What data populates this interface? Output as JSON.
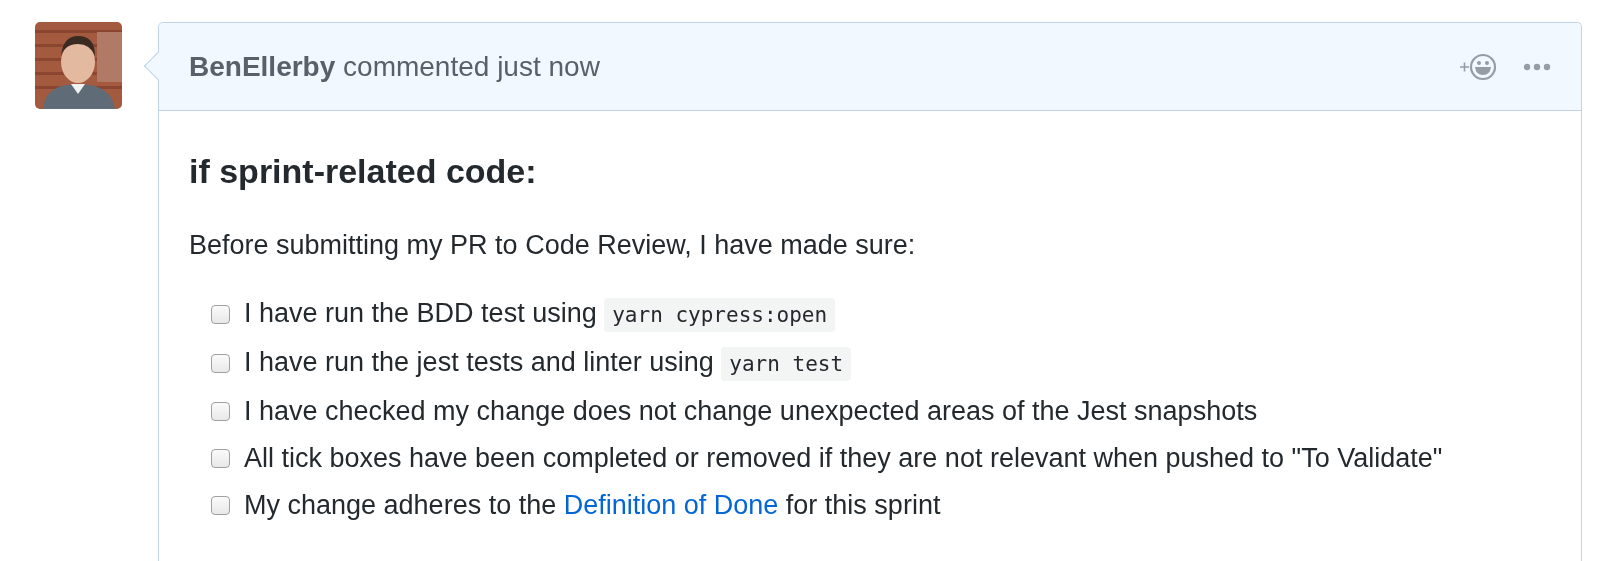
{
  "comment": {
    "author": "BenEllerby",
    "action": "commented just now",
    "heading": "if sprint-related code:",
    "intro": "Before submitting my PR to Code Review, I have made sure:",
    "tasks": [
      {
        "checked": false,
        "parts": [
          {
            "kind": "text",
            "text": "I have run the BDD test using "
          },
          {
            "kind": "code",
            "text": "yarn cypress:open"
          }
        ]
      },
      {
        "checked": false,
        "parts": [
          {
            "kind": "text",
            "text": "I have run the jest tests and linter using "
          },
          {
            "kind": "code",
            "text": "yarn test"
          }
        ]
      },
      {
        "checked": false,
        "parts": [
          {
            "kind": "text",
            "text": "I have checked my change does not change unexpected areas of the Jest snapshots"
          }
        ]
      },
      {
        "checked": false,
        "parts": [
          {
            "kind": "text",
            "text": "All tick boxes have been completed or removed if they are not relevant when pushed to \"To Validate\""
          }
        ]
      },
      {
        "checked": false,
        "parts": [
          {
            "kind": "text",
            "text": "My change adheres to the "
          },
          {
            "kind": "link",
            "text": "Definition of Done"
          },
          {
            "kind": "text",
            "text": " for this sprint"
          }
        ]
      }
    ]
  }
}
